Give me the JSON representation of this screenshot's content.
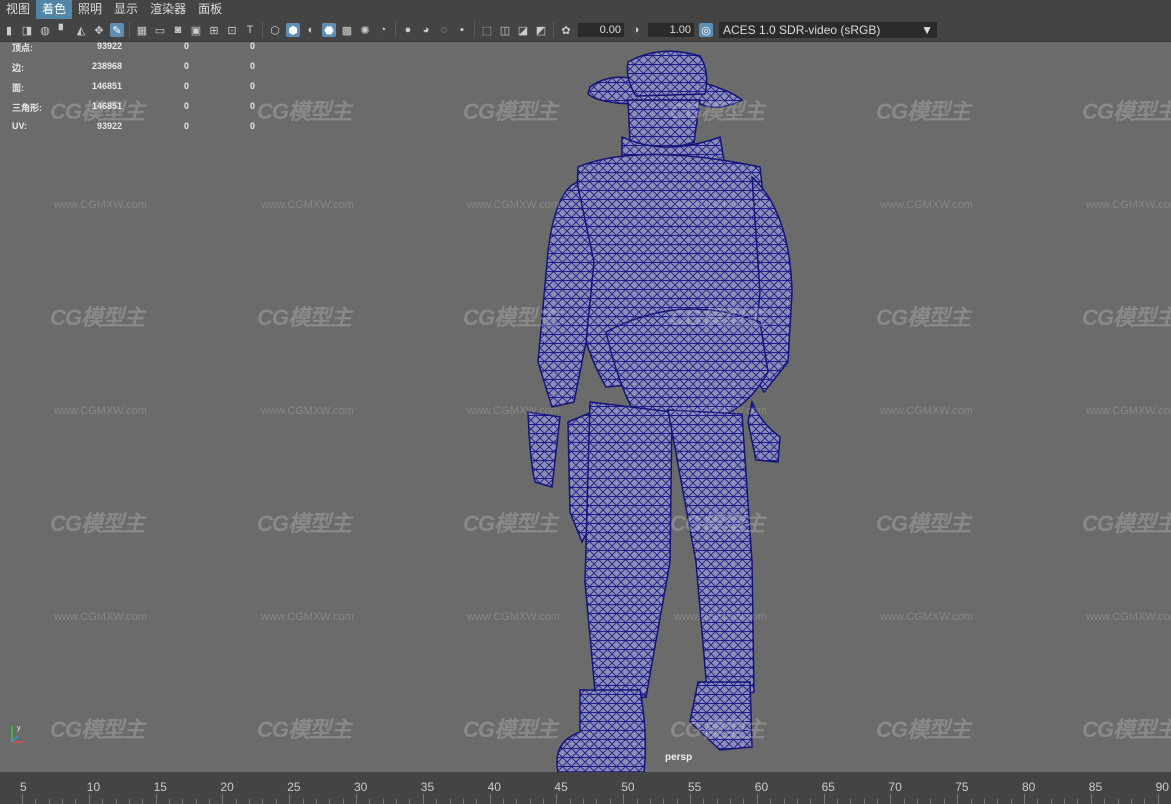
{
  "menu": [
    "视图",
    "着色",
    "照明",
    "显示",
    "渲染器",
    "面板"
  ],
  "active_menu_index": 1,
  "toolbar": {
    "exposure": "0.00",
    "gamma": "1.00",
    "color_space": "ACES 1.0 SDR-video (sRGB)"
  },
  "stats": [
    {
      "label": "顶点:",
      "v1": "93922",
      "v2": "0",
      "v3": "0"
    },
    {
      "label": "边:",
      "v1": "238968",
      "v2": "0",
      "v3": "0"
    },
    {
      "label": "面:",
      "v1": "146851",
      "v2": "0",
      "v3": "0"
    },
    {
      "label": "三角形:",
      "v1": "146851",
      "v2": "0",
      "v3": "0"
    },
    {
      "label": "UV:",
      "v1": "93922",
      "v2": "0",
      "v3": "0"
    }
  ],
  "camera_label": "persp",
  "watermark": {
    "logo": "CG模型主",
    "url": "www.CGMXW.com"
  },
  "timeline_ticks": [
    "5",
    "10",
    "15",
    "20",
    "25",
    "30",
    "35",
    "40",
    "45",
    "50",
    "55",
    "60",
    "65",
    "70",
    "75",
    "80",
    "85",
    "90"
  ],
  "colors": {
    "mesh": "#1c1c8c",
    "viewport": "#6b6b6b",
    "ui": "#444444",
    "accent": "#5285a6"
  }
}
